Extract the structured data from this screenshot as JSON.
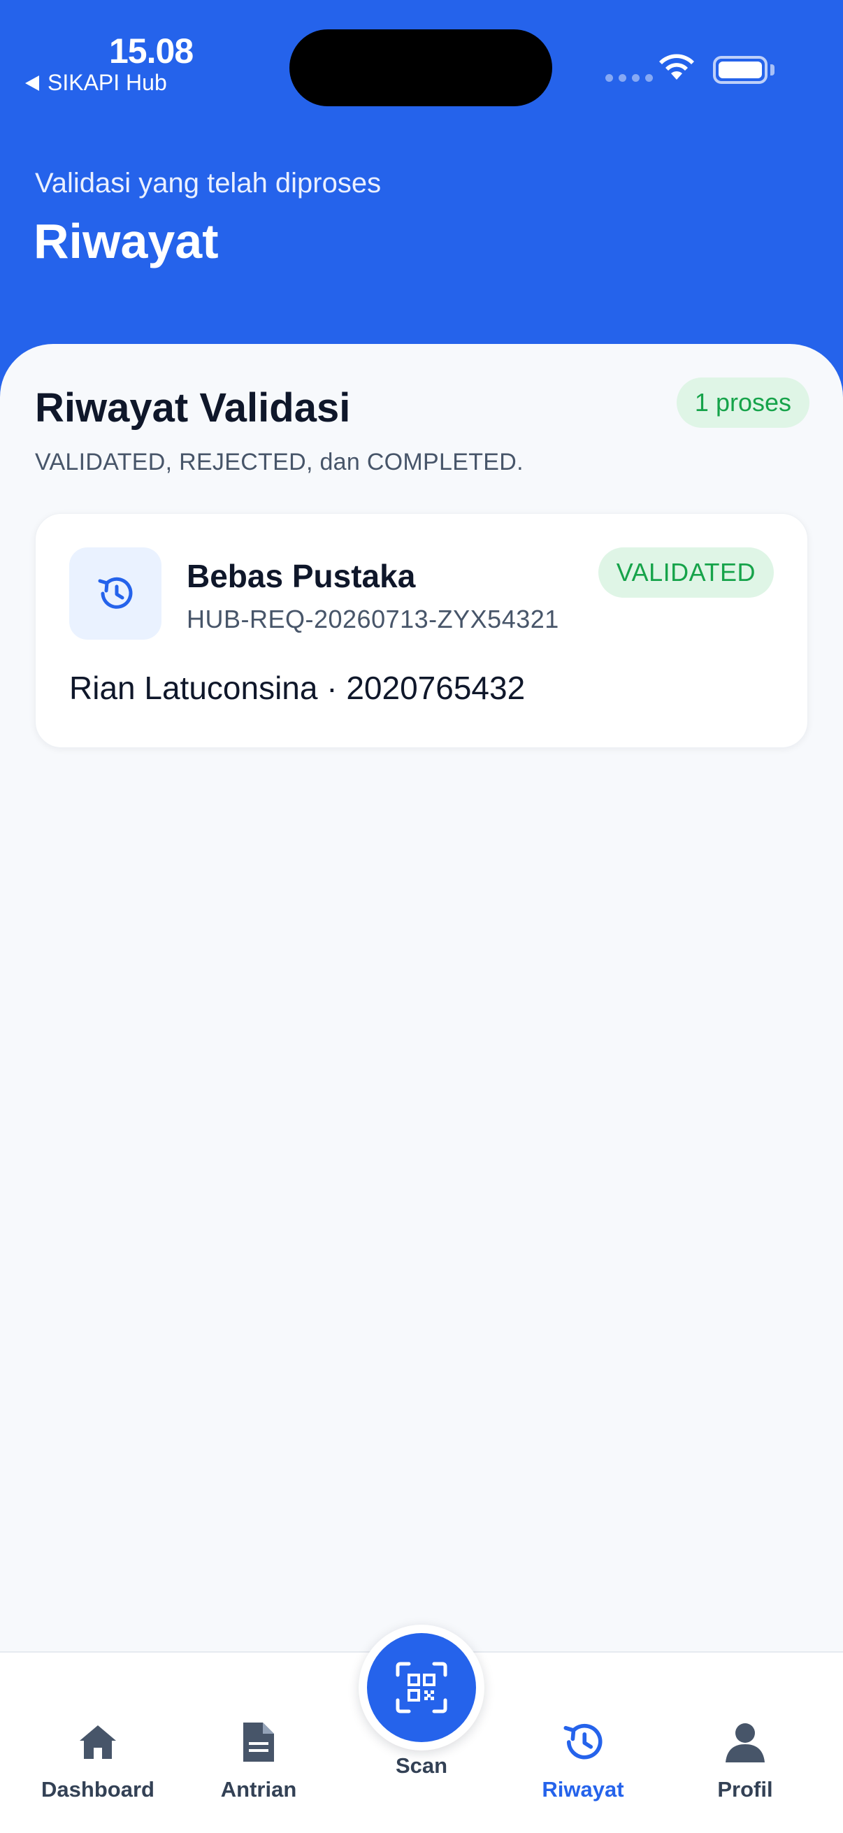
{
  "status_bar": {
    "time": "15.08",
    "back_app": "SIKAPI Hub"
  },
  "header": {
    "subtitle": "Validasi yang telah diproses",
    "title": "Riwayat"
  },
  "history": {
    "section_title": "Riwayat Validasi",
    "count_badge": "1 proses",
    "description": "VALIDATED, REJECTED, dan COMPLETED.",
    "items": [
      {
        "title": "Bebas Pustaka",
        "code": "HUB-REQ-20260713-ZYX54321",
        "status": "VALIDATED",
        "person": "Rian Latuconsina · 2020765432",
        "icon": "history-icon"
      }
    ]
  },
  "tabbar": {
    "items": [
      {
        "label": "Dashboard",
        "icon": "home-icon",
        "active": false
      },
      {
        "label": "Antrian",
        "icon": "document-icon",
        "active": false
      },
      {
        "label": "Scan",
        "icon": "qr-scan-icon",
        "active": false
      },
      {
        "label": "Riwayat",
        "icon": "history-icon",
        "active": true
      },
      {
        "label": "Profil",
        "icon": "user-icon",
        "active": false
      }
    ]
  },
  "colors": {
    "primary": "#2563eb",
    "success_bg": "#dff5e6",
    "success_text": "#16a34a",
    "sheet_bg": "#f7f9fc"
  }
}
